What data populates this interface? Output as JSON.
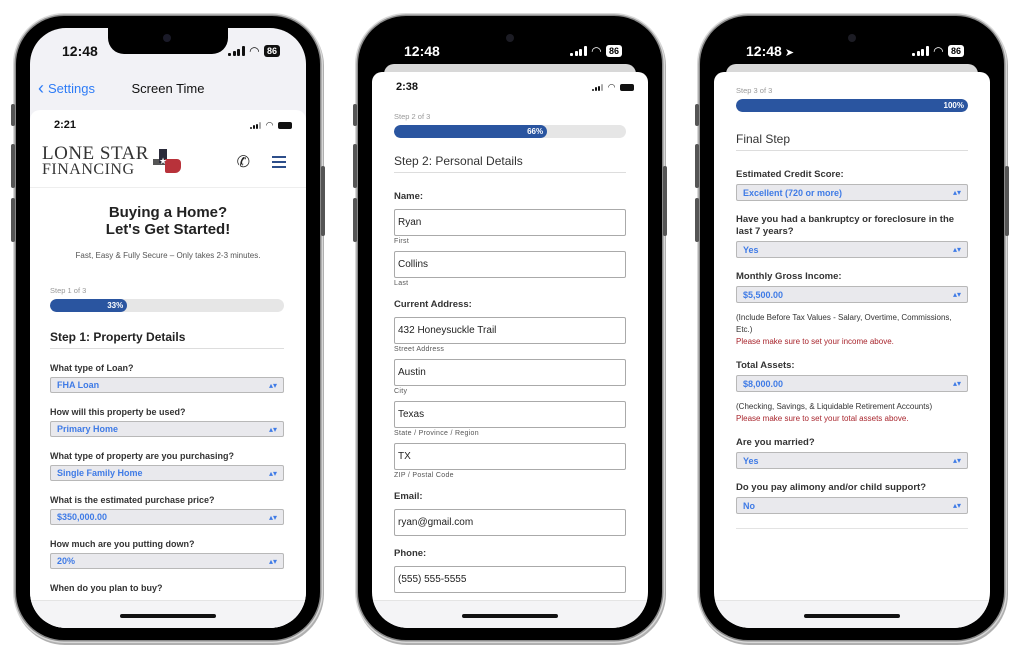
{
  "phones": [
    {
      "outer_status": {
        "time": "12:48",
        "battery": "86",
        "location_arrow": false
      },
      "nav": {
        "back_label": "Settings",
        "title": "Screen Time"
      },
      "inner_status": {
        "time": "2:21"
      },
      "brand": {
        "line1": "Lone Star",
        "line2": "Financing"
      },
      "hero": {
        "title_line1": "Buying a Home?",
        "title_line2": "Let's Get Started!",
        "subtitle": "Fast, Easy & Fully Secure – Only takes 2-3 minutes."
      },
      "step_label": "Step 1 of 3",
      "progress": {
        "value": 33,
        "label": "33%"
      },
      "section_title": "Step 1: Property Details",
      "fields": [
        {
          "label": "What type of Loan?",
          "value": "FHA Loan"
        },
        {
          "label": "How will this property be used?",
          "value": "Primary Home"
        },
        {
          "label": "What type of property are you purchasing?",
          "value": "Single Family Home"
        },
        {
          "label": "What is the estimated purchase price?",
          "value": "$350,000.00"
        },
        {
          "label": "How much are you putting down?",
          "value": "20%"
        }
      ],
      "next_label": "When do you plan to buy?"
    },
    {
      "outer_status": {
        "time": "12:48",
        "battery": "86",
        "location_arrow": false
      },
      "inner_status": {
        "time": "2:38"
      },
      "step_label": "Step 2 of 3",
      "progress": {
        "value": 66,
        "label": "66%"
      },
      "section_title": "Step 2: Personal Details",
      "name_label": "Name:",
      "first": {
        "value": "Ryan",
        "sublabel": "First"
      },
      "last": {
        "value": "Collins",
        "sublabel": "Last"
      },
      "address_label": "Current Address:",
      "street": {
        "value": "432 Honeysuckle Trail",
        "sublabel": "Street Address"
      },
      "city": {
        "value": "Austin",
        "sublabel": "City"
      },
      "state": {
        "value": "Texas",
        "sublabel": "State / Province / Region"
      },
      "zip": {
        "value": "TX",
        "sublabel": "ZIP / Postal Code"
      },
      "email": {
        "label": "Email:",
        "value": "ryan@gmail.com"
      },
      "phone": {
        "label": "Phone:",
        "value": "(555) 555-5555"
      }
    },
    {
      "outer_status": {
        "time": "12:48",
        "battery": "86",
        "location_arrow": true
      },
      "step_label": "Step 3 of 3",
      "progress": {
        "value": 100,
        "label": "100%"
      },
      "section_title": "Final Step",
      "credit": {
        "label": "Estimated Credit Score:",
        "value": "Excellent (720 or more)"
      },
      "bankruptcy": {
        "label": "Have you had a bankruptcy or foreclosure in the last 7 years?",
        "value": "Yes"
      },
      "income": {
        "label": "Monthly Gross Income:",
        "value": "$5,500.00",
        "help": "(Include Before Tax Values - Salary, Overtime, Commissions, Etc.)",
        "warning": "Please make sure to set your income above."
      },
      "assets": {
        "label": "Total Assets:",
        "value": "$8,000.00",
        "help": "(Checking, Savings, & Liquidable Retirement Accounts)",
        "warning": "Please make sure to set your total assets above."
      },
      "married": {
        "label": "Are you married?",
        "value": "Yes"
      },
      "alimony": {
        "label": "Do you pay alimony and/or child support?",
        "value": "No"
      }
    }
  ],
  "colors": {
    "accent": "#2a55a0",
    "select_text": "#3f7be6",
    "warning": "#a8252d",
    "ios_link": "#2e7cf6"
  }
}
